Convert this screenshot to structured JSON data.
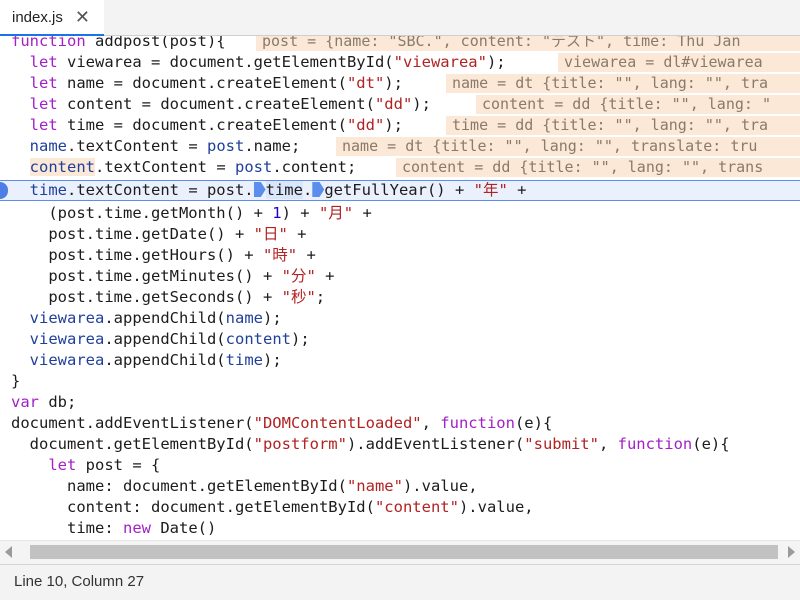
{
  "tab": {
    "filename": "index.js",
    "close_glyph": "✕"
  },
  "status": {
    "position": "Line 10, Column 27"
  },
  "colors": {
    "accent": "#1a73e8",
    "breakpoint": "#4d7ee8",
    "keyword": "#a31fc8",
    "string": "#b22222",
    "inline_value_bg": "#fbe8d7"
  },
  "icons": {
    "breakpoint": "breakpoint-marker-icon",
    "pause_arrow": "pause-location-icon"
  },
  "code": {
    "l1": [
      "function",
      " addpost(post){"
    ],
    "l1_inline": "post = {name: \"SBC.\", content: \"テスト\", time: Thu Jan",
    "l2": [
      "let",
      " viewarea = document.getElementById(",
      "\"viewarea\"",
      ");"
    ],
    "l2_inline": "viewarea = dl#viewarea",
    "l3": [
      "let",
      " name = document.createElement(",
      "\"dt\"",
      ");"
    ],
    "l3_inline": "name = dt {title: \"\", lang: \"\", tra",
    "l4": [
      "let",
      " content = document.createElement(",
      "\"dd\"",
      ");"
    ],
    "l4_inline": "content = dd {title: \"\", lang: \"",
    "l5": [
      "let",
      " time = document.createElement(",
      "\"dd\"",
      ");"
    ],
    "l5_inline": "time = dd {title: \"\", lang: \"\", tra",
    "l6": [
      "name",
      ".textContent = ",
      "post",
      ".name;"
    ],
    "l6_inline": "name = dt {title: \"\", lang: \"\", translate: tru",
    "l7": [
      "content",
      ".textContent = ",
      "post",
      ".content;"
    ],
    "l7_inline": "content = dd {title: \"\", lang: \"\", trans",
    "l8": [
      "time",
      ".textContent = post.",
      "time",
      ".",
      "getFullYear() + ",
      "\"年\"",
      " +"
    ],
    "l9": [
      "(post.time.getMonth() + ",
      "1",
      ") + ",
      "\"月\"",
      " +"
    ],
    "l10": [
      "post.time.getDate() + ",
      "\"日\"",
      " +"
    ],
    "l11": [
      "post.time.getHours() + ",
      "\"時\"",
      " +"
    ],
    "l12": [
      "post.time.getMinutes() + ",
      "\"分\"",
      " +"
    ],
    "l13": [
      "post.time.getSeconds() + ",
      "\"秒\"",
      ";"
    ],
    "l14": [
      "viewarea",
      ".appendChild(",
      "name",
      ");"
    ],
    "l15": [
      "viewarea",
      ".appendChild(",
      "content",
      ");"
    ],
    "l16": [
      "viewarea",
      ".appendChild(",
      "time",
      ");"
    ],
    "l17": "}",
    "l18": [
      "var",
      " db;"
    ],
    "l19": [
      "document.addEventListener(",
      "\"DOMContentLoaded\"",
      ", ",
      "function",
      "(e){"
    ],
    "l20": [
      "document.getElementById(",
      "\"postform\"",
      ").addEventListener(",
      "\"submit\"",
      ", ",
      "function",
      "(e){"
    ],
    "l21": [
      "let",
      " post = {"
    ],
    "l22": [
      "name: document.getElementById(",
      "\"name\"",
      ").value,"
    ],
    "l23": [
      "content: document.getElementById(",
      "\"content\"",
      ").value,"
    ],
    "l24": [
      "time: ",
      "new",
      " Date()"
    ]
  }
}
